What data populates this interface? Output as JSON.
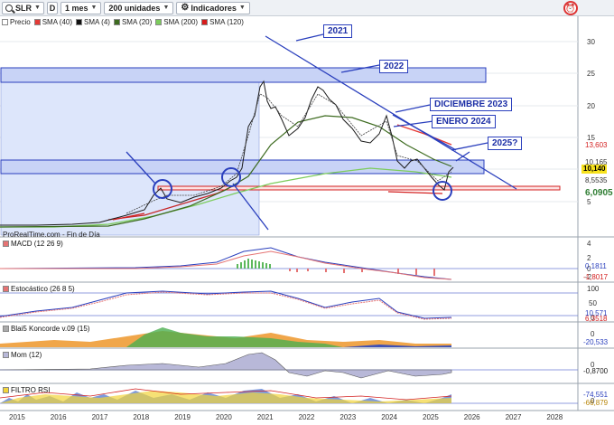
{
  "toolbar": {
    "symbol": "SLR",
    "d_label": "D",
    "period": "1 mes",
    "units": "200 unidades",
    "indicators": "Indicadores"
  },
  "legend": [
    {
      "label": "Precio",
      "color": "#ffffff"
    },
    {
      "label": "SMA (40)",
      "color": "#e53935"
    },
    {
      "label": "SMA (4)",
      "color": "#111111"
    },
    {
      "label": "SMA (20)",
      "color": "#3d6b1f"
    },
    {
      "label": "SMA (200)",
      "color": "#7ccc5c"
    },
    {
      "label": "SMA (120)",
      "color": "#d81b1b"
    }
  ],
  "source": "ProRealTime.com - Fin de Día",
  "annotations": [
    "2021",
    "2022",
    "DICIEMBRE 2023",
    "ENERO 2024",
    "2025?"
  ],
  "price_axis": [
    "30",
    "25",
    "20",
    "15",
    "10",
    "5"
  ],
  "price_tags": [
    "13,603",
    "10,165",
    "10,140",
    "8,5535",
    "6,0905"
  ],
  "panes": {
    "macd": {
      "label": "MACD (12 26 9)",
      "ticks": [
        "4",
        "2",
        "0",
        "-2"
      ],
      "tags": [
        "0,1811",
        "-1,8017"
      ]
    },
    "stoch": {
      "label": "Estocástico (26 8 5)",
      "ticks": [
        "100",
        "50",
        "0"
      ],
      "tags": [
        "10,571",
        "6,3518"
      ]
    },
    "blai": {
      "label": "Blai5 Koncorde v.09 (15)",
      "ticks": [
        "0"
      ],
      "tags": [
        "-20,533"
      ]
    },
    "mom": {
      "label": "Mom (12)",
      "ticks": [
        "0"
      ],
      "tags": [
        "-0,8700"
      ]
    },
    "rsi": {
      "label": "FILTRO RSI",
      "ticks": [
        "0"
      ],
      "tags": [
        "-74,551",
        "-66,879"
      ]
    }
  },
  "years": [
    "2015",
    "2016",
    "2017",
    "2018",
    "2019",
    "2020",
    "2021",
    "2022",
    "2023",
    "2024",
    "2025",
    "2026",
    "2027",
    "2028"
  ]
}
